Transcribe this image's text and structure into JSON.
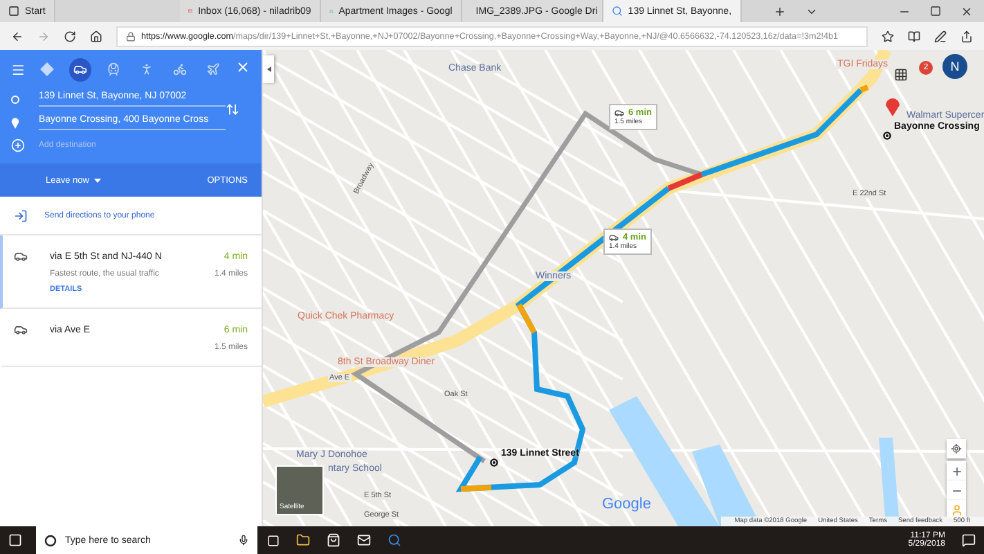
{
  "browser": {
    "tabs": [
      {
        "title": "Start",
        "selected": false
      },
      {
        "title": "Inbox (16,068) - niladrib09",
        "selected": false
      },
      {
        "title": "Apartment Images - Googl",
        "selected": false
      },
      {
        "title": "IMG_2389.JPG - Google Dri",
        "selected": false
      },
      {
        "title": "139 Linnet St, Bayonne,",
        "selected": true
      }
    ],
    "url_host": "https://www.google.com",
    "url_path": "/maps/dir/139+Linnet+St,+Bayonne,+NJ+07002/Bayonne+Crossing,+Bayonne+Crossing+Way,+Bayonne,+NJ/@40.6566632,-74.120523,16z/data=!3m2!4b1"
  },
  "sidebar": {
    "modes": [
      {
        "kind": "best",
        "selected": false
      },
      {
        "kind": "car",
        "selected": true
      },
      {
        "kind": "train",
        "selected": false
      },
      {
        "kind": "walk",
        "selected": false
      },
      {
        "kind": "bike",
        "selected": false
      },
      {
        "kind": "plane",
        "selected": false
      }
    ],
    "origin": "139 Linnet St, Bayonne, NJ 07002",
    "destination": "Bayonne Crossing, 400 Bayonne Cross",
    "add_destination": "Add destination",
    "leave_now": "Leave now",
    "options": "OPTIONS",
    "send": "Send directions to your phone",
    "routes": [
      {
        "via": "via E 5th St and NJ-440 N",
        "note": "Fastest route, the usual traffic",
        "details": "DETAILS",
        "time": "4 min",
        "distance": "1.4 miles",
        "selected": true
      },
      {
        "via": "via Ave E",
        "time": "6 min",
        "distance": "1.5 miles",
        "selected": false
      }
    ]
  },
  "map": {
    "labels": [
      {
        "text": "TGI Fridays",
        "kind": "food"
      },
      {
        "text": "Chase Bank",
        "kind": "poi"
      },
      {
        "text": "Walmart Supercer",
        "kind": "poi"
      },
      {
        "text": "Broadway",
        "kind": "street"
      },
      {
        "text": "E 22nd St",
        "kind": "street"
      },
      {
        "text": "Winners",
        "kind": "poi"
      },
      {
        "text": "Quick Chek Pharmacy",
        "kind": "food"
      },
      {
        "text": "8th St Broadway Diner",
        "kind": "food"
      },
      {
        "text": "Ave E",
        "kind": "street"
      },
      {
        "text": "Oak St",
        "kind": "street"
      },
      {
        "text": "Mary J Donohoe",
        "kind": "poi"
      },
      {
        "text": "ntary School",
        "kind": "poi"
      },
      {
        "text": "E 5th St",
        "kind": "street"
      },
      {
        "text": "George St",
        "kind": "street"
      }
    ],
    "callouts": [
      {
        "time": "6 min",
        "distance": "1.5 miles"
      },
      {
        "time": "4 min",
        "distance": "1.4 miles"
      }
    ],
    "origin_marker": "139 Linnet Street",
    "destination_marker": "Bayonne Crossing",
    "satellite": "Satellite",
    "logo": "Google",
    "notifications": "2",
    "avatar": "N",
    "footer": [
      "Map data ©2018 Google",
      "United States",
      "Terms",
      "Send feedback",
      "500 ft"
    ]
  },
  "taskbar": {
    "search": "Type here to search",
    "time": "11:17 PM",
    "date": "5/29/2018"
  }
}
